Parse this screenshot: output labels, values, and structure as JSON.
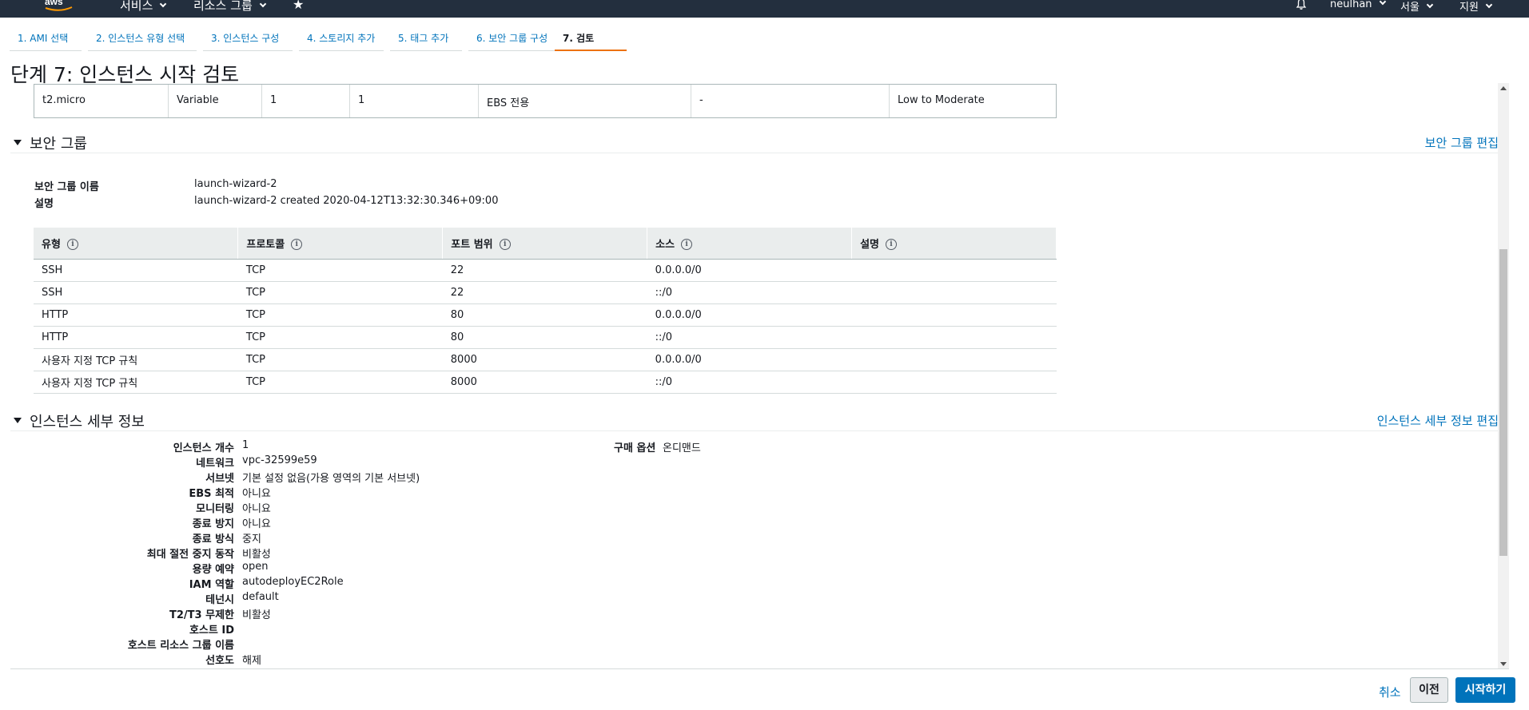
{
  "topnav": {
    "services": "서비스",
    "resource_groups": "리소스 그룹",
    "user": "neulhan",
    "region": "서울",
    "support": "지원",
    "star_icon": "star",
    "bell_icon": "bell"
  },
  "tabs": [
    "1. AMI 선택",
    "2. 인스턴스 유형 선택",
    "3. 인스턴스 구성",
    "4. 스토리지 추가",
    "5. 태그 추가",
    "6. 보안 그룹 구성",
    "7. 검토"
  ],
  "page_title": "단계 7: 인스턴스 시작 검토",
  "instance_type_row": [
    "t2.micro",
    "Variable",
    "1",
    "1",
    "EBS 전용",
    "-",
    "Low to Moderate"
  ],
  "security_group": {
    "title": "보안 그룹",
    "edit": "보안 그룹 편집",
    "name_label": "보안 그룹 이름",
    "name_value": "launch-wizard-2",
    "desc_label": "설명",
    "desc_value": "launch-wizard-2 created 2020-04-12T13:32:30.346+09:00",
    "columns": [
      "유형",
      "프로토콜",
      "포트 범위",
      "소스",
      "설명"
    ],
    "rows": [
      [
        "SSH",
        "TCP",
        "22",
        "0.0.0.0/0",
        ""
      ],
      [
        "SSH",
        "TCP",
        "22",
        "::/0",
        ""
      ],
      [
        "HTTP",
        "TCP",
        "80",
        "0.0.0.0/0",
        ""
      ],
      [
        "HTTP",
        "TCP",
        "80",
        "::/0",
        ""
      ],
      [
        "사용자 지정 TCP 규칙",
        "TCP",
        "8000",
        "0.0.0.0/0",
        ""
      ],
      [
        "사용자 지정 TCP 규칙",
        "TCP",
        "8000",
        "::/0",
        ""
      ]
    ]
  },
  "instance_details": {
    "title": "인스턴스 세부 정보",
    "edit": "인스턴스 세부 정보 편집",
    "items": [
      {
        "k": "인스턴스 개수",
        "v": "1"
      },
      {
        "k": "네트워크",
        "v": "vpc-32599e59"
      },
      {
        "k": "서브넷",
        "v": "기본 설정 없음(가용 영역의 기본 서브넷)"
      },
      {
        "k": "EBS 최적",
        "v": "아니요"
      },
      {
        "k": "모니터링",
        "v": "아니요"
      },
      {
        "k": "종료 방지",
        "v": "아니요"
      },
      {
        "k": "종료 방식",
        "v": "중지"
      },
      {
        "k": "최대 절전 중지 동작",
        "v": "비활성"
      },
      {
        "k": "용량 예약",
        "v": "open"
      },
      {
        "k": "IAM 역할",
        "v": "autodeployEC2Role"
      },
      {
        "k": "테넌시",
        "v": "default"
      },
      {
        "k": "T2/T3 무제한",
        "v": "비활성"
      },
      {
        "k": "호스트 ID",
        "v": ""
      },
      {
        "k": "호스트 리소스 그룹 이름",
        "v": ""
      },
      {
        "k": "선호도",
        "v": "해제"
      }
    ],
    "purchase_label": "구매 옵션",
    "purchase_value": "온디맨드"
  },
  "footer": {
    "cancel": "취소",
    "previous": "이전",
    "launch": "시작하기"
  }
}
